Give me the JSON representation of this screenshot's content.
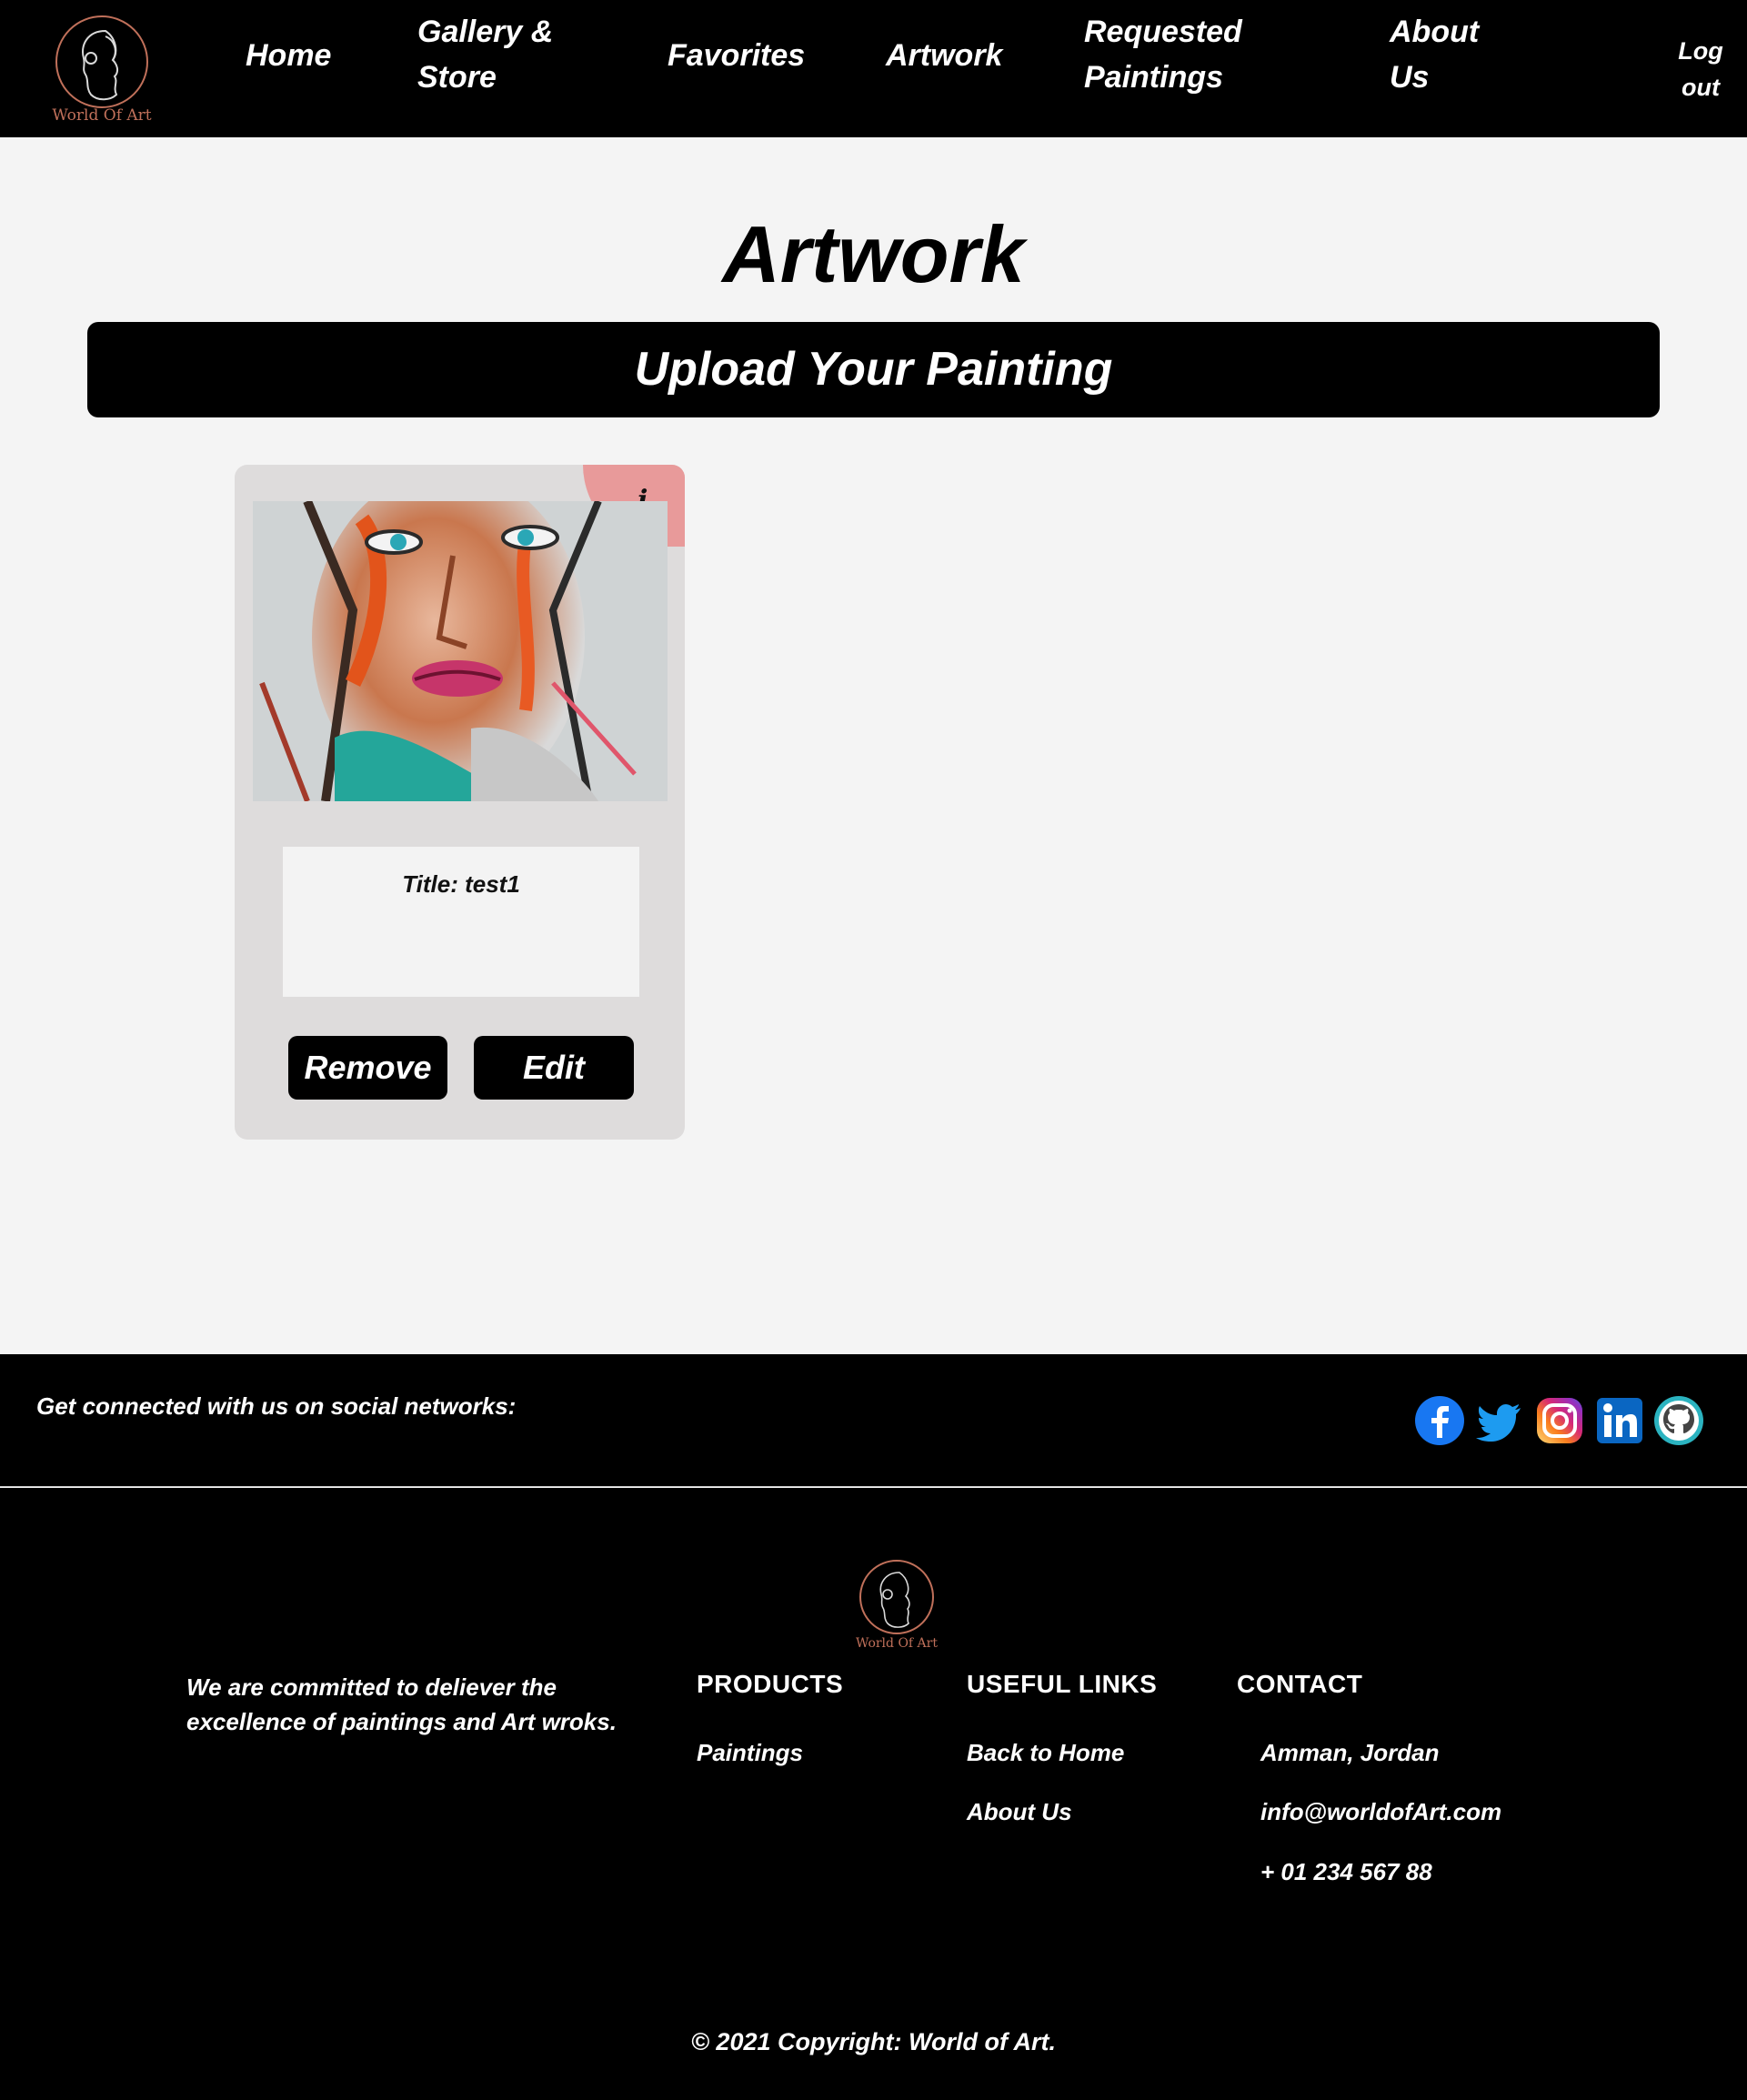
{
  "nav": {
    "logo_text": "World Of Art",
    "items": [
      {
        "label": "Home"
      },
      {
        "label": "Gallery & Store"
      },
      {
        "label": "Favorites"
      },
      {
        "label": "Artwork"
      },
      {
        "label": "Requested Paintings"
      },
      {
        "label": "About Us"
      }
    ],
    "logout": "Log out"
  },
  "main": {
    "title": "Artwork",
    "upload_button": "Upload Your Painting",
    "card": {
      "info_label": "i",
      "title_text": "Title: test1",
      "remove_label": "Remove",
      "edit_label": "Edit"
    }
  },
  "social": {
    "text": "Get connected with us on social networks:",
    "icons": [
      "facebook-icon",
      "twitter-icon",
      "instagram-icon",
      "linkedin-icon",
      "github-icon"
    ]
  },
  "footer": {
    "logo_text": "World Of Art",
    "tagline": "We are committed to deliever the excellence of paintings and Art wroks.",
    "products_heading": "PRODUCTS",
    "products": [
      "Paintings"
    ],
    "useful_heading": "USEFUL LINKS",
    "useful_links": [
      "Back to Home",
      "About Us"
    ],
    "contact_heading": "CONTACT",
    "contact": [
      "Amman, Jordan",
      "info@worldofArt.com",
      "+ 01 234 567 88"
    ],
    "copyright": "© 2021 Copyright: World of Art."
  },
  "colors": {
    "nav_bg": "#000000",
    "page_bg": "#f4f4f4",
    "card_bg": "#dedcdc",
    "info_badge": "#e89a9a",
    "logo_accent": "#c0705a"
  }
}
